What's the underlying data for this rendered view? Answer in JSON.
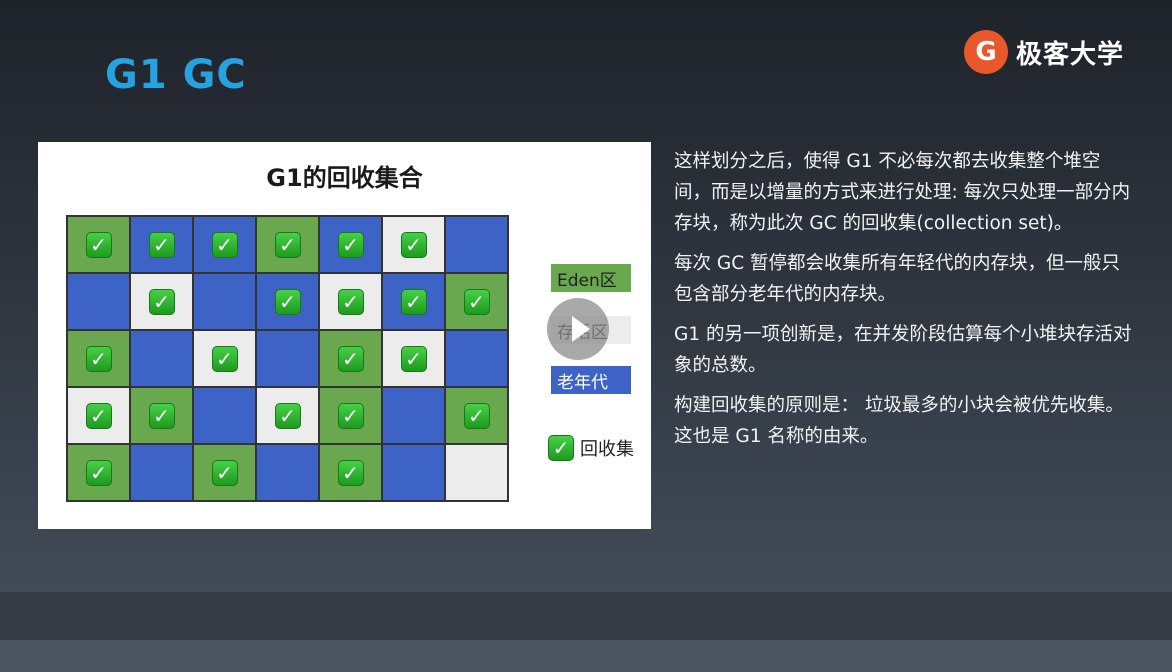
{
  "slide": {
    "title": "G1 GC",
    "logo_glyph": "G",
    "logo_text": "极客大学"
  },
  "figure": {
    "title": "G1的回收集合",
    "grid": [
      [
        {
          "t": "eden",
          "c": true
        },
        {
          "t": "old",
          "c": true
        },
        {
          "t": "old",
          "c": true
        },
        {
          "t": "eden",
          "c": true
        },
        {
          "t": "old",
          "c": true
        },
        {
          "t": "surv",
          "c": true
        },
        {
          "t": "old",
          "c": false
        }
      ],
      [
        {
          "t": "old",
          "c": false
        },
        {
          "t": "surv",
          "c": true
        },
        {
          "t": "old",
          "c": false
        },
        {
          "t": "old",
          "c": true
        },
        {
          "t": "surv",
          "c": true
        },
        {
          "t": "old",
          "c": true
        },
        {
          "t": "eden",
          "c": true
        }
      ],
      [
        {
          "t": "eden",
          "c": true
        },
        {
          "t": "old",
          "c": false
        },
        {
          "t": "surv",
          "c": true
        },
        {
          "t": "old",
          "c": false
        },
        {
          "t": "eden",
          "c": true
        },
        {
          "t": "surv",
          "c": true
        },
        {
          "t": "old",
          "c": false
        }
      ],
      [
        {
          "t": "surv",
          "c": true
        },
        {
          "t": "eden",
          "c": true
        },
        {
          "t": "old",
          "c": false
        },
        {
          "t": "surv",
          "c": true
        },
        {
          "t": "eden",
          "c": true
        },
        {
          "t": "old",
          "c": false
        },
        {
          "t": "eden",
          "c": true
        }
      ],
      [
        {
          "t": "eden",
          "c": true
        },
        {
          "t": "old",
          "c": false
        },
        {
          "t": "eden",
          "c": true
        },
        {
          "t": "old",
          "c": false
        },
        {
          "t": "eden",
          "c": true
        },
        {
          "t": "old",
          "c": false
        },
        {
          "t": "surv",
          "c": false
        }
      ]
    ],
    "legend": {
      "eden": "Eden区",
      "survivor": "存活区",
      "old": "老年代",
      "collection": "回收集"
    },
    "check_glyph": "✓"
  },
  "body": {
    "p1": "这样划分之后，使得 G1 不必每次都去收集整个堆空间，而是以增量的方式来进行处理: 每次只处理一部分内存块，称为此次 GC 的回收集(collection set)。",
    "p2": "每次 GC 暂停都会收集所有年轻代的内存块，但一般只包含部分老年代的内存块。",
    "p3": "G1 的另一项创新是，在并发阶段估算每个小堆块存活对象的总数。",
    "p4": "构建回收集的原则是： 垃圾最多的小块会被优先收集。这也是 G1 名称的由来。"
  },
  "colors": {
    "eden": "#6aa84f",
    "old": "#3d63c7",
    "survivor": "#ececec",
    "title": "#27a2e0",
    "logo": "#e8582a"
  }
}
